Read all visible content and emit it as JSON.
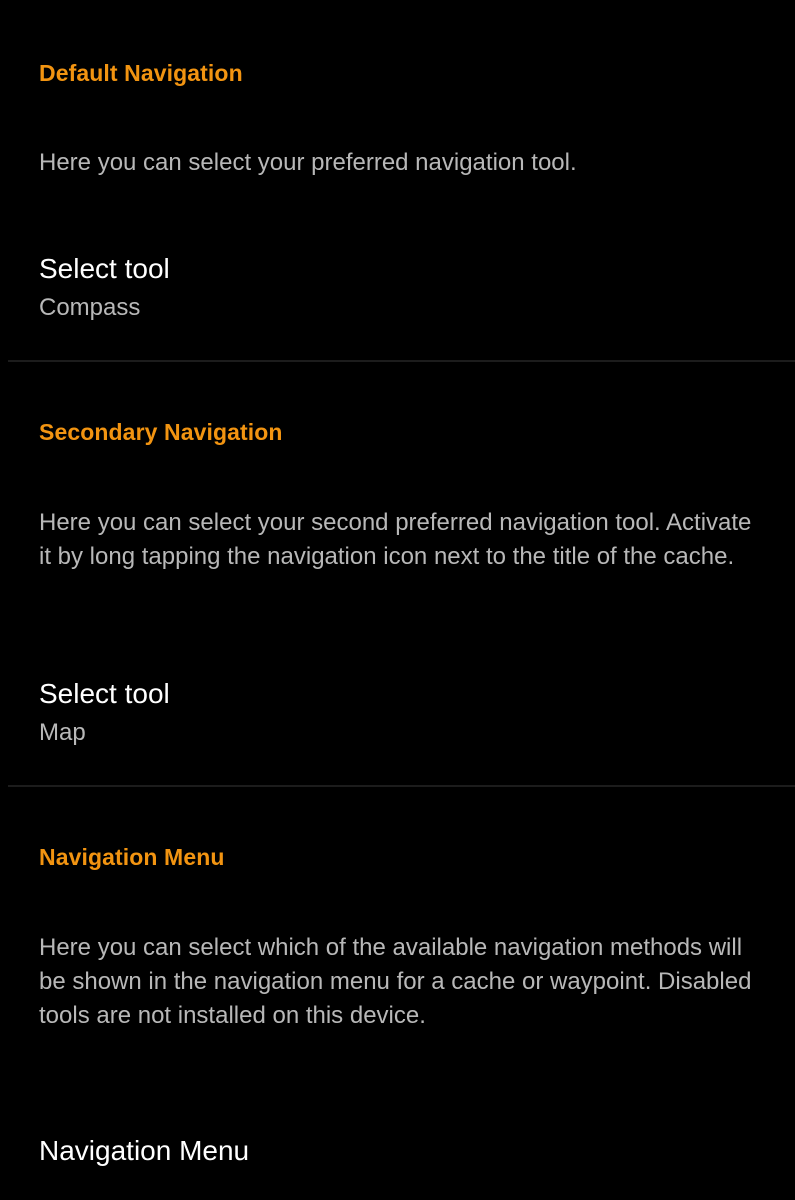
{
  "sections": [
    {
      "header": "Default Navigation",
      "description": "Here you can select your preferred navigation tool.",
      "pref_title": "Select tool",
      "pref_value": "Compass"
    },
    {
      "header": "Secondary Navigation",
      "description": "Here you can select your second preferred navigation tool. Activate it by long tapping the navigation icon next to the title of the cache.",
      "pref_title": "Select tool",
      "pref_value": "Map"
    },
    {
      "header": "Navigation Menu",
      "description": "Here you can select which of the available navigation methods will be shown in the navigation menu for a cache or waypoint. Disabled tools are not installed on this device.",
      "pref_title": "Navigation Menu"
    }
  ],
  "colors": {
    "background": "#000000",
    "accent": "#f29411",
    "primary_text": "#ffffff",
    "secondary_text": "#b8b8b8",
    "divider": "#1c1c1c"
  }
}
